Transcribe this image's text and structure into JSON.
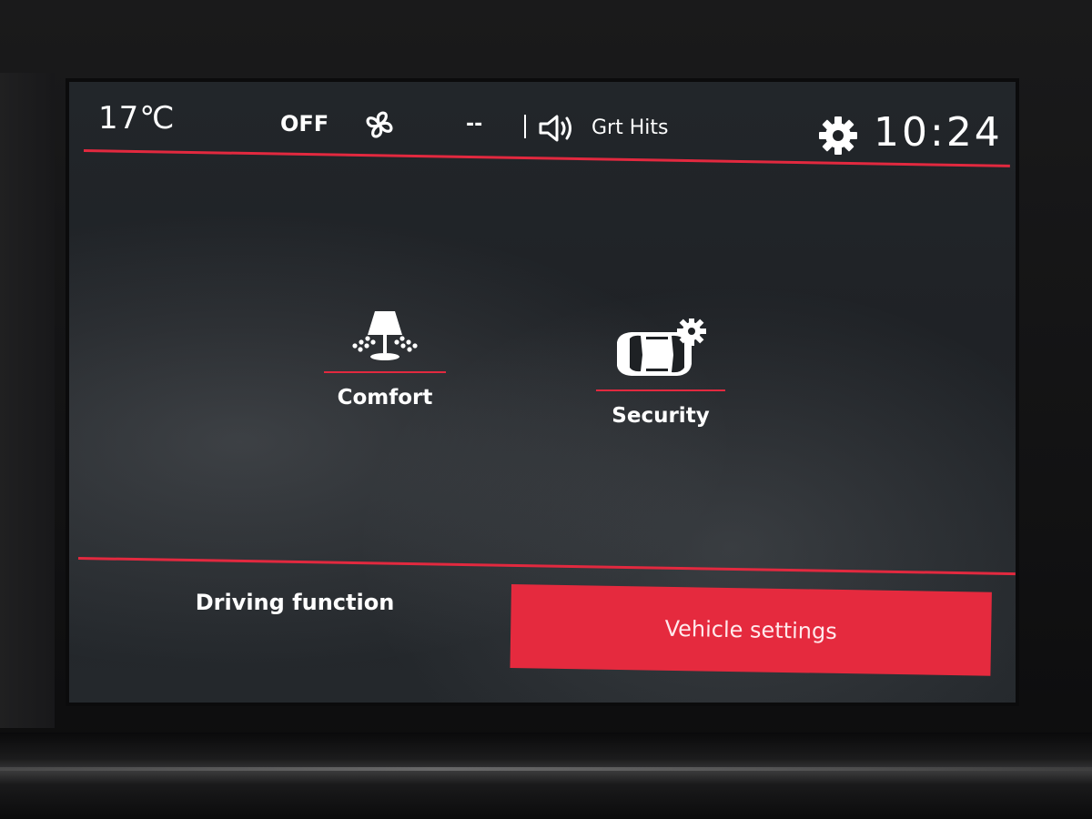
{
  "status_bar": {
    "temperature": "17℃",
    "ac_status": "OFF",
    "fan_icon": "fan-icon",
    "media_placeholder": "--",
    "volume_icon": "speaker-icon",
    "radio_station": "Grt Hits",
    "settings_icon": "gear-icon",
    "clock": "10:24"
  },
  "menu": {
    "items": [
      {
        "label": "Comfort",
        "icon": "lamp-icon"
      },
      {
        "label": "Security",
        "icon": "car-gear-icon"
      }
    ]
  },
  "tabs": [
    {
      "label": "Driving function",
      "active": false
    },
    {
      "label": "Vehicle settings",
      "active": true
    }
  ],
  "colors": {
    "accent": "#e2293f",
    "screen_bg": "#1e2124",
    "text": "#ffffff"
  }
}
